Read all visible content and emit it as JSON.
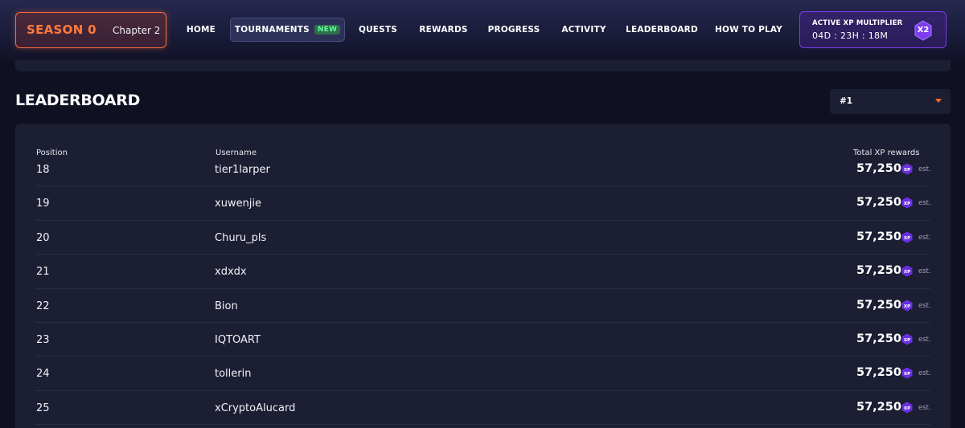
{
  "season": {
    "title": "SEASON 0",
    "chapter": "Chapter 2"
  },
  "nav": {
    "home": "HOME",
    "tournaments": "TOURNAMENTS",
    "tournaments_badge": "NEW",
    "quests": "QUESTS",
    "rewards": "REWARDS",
    "progress": "PROGRESS",
    "activity": "ACTIVITY",
    "leaderboard": "LEADERBOARD",
    "how_to_play": "HOW TO PLAY"
  },
  "multiplier": {
    "title": "ACTIVE XP MULTIPLIER",
    "timer": "04D : 23H : 18M",
    "badge": "X2"
  },
  "page": {
    "title": "LEADERBOARD",
    "rank_select": "#1"
  },
  "table": {
    "headers": {
      "position": "Position",
      "username": "Username",
      "xp": "Total XP rewards"
    },
    "xp_icon_label": "XP",
    "est_label": "est.",
    "rows": [
      {
        "position": "18",
        "username": "tier1larper",
        "xp": "57,250"
      },
      {
        "position": "19",
        "username": "xuwenjie",
        "xp": "57,250"
      },
      {
        "position": "20",
        "username": "Churu_pls",
        "xp": "57,250"
      },
      {
        "position": "21",
        "username": "xdxdx",
        "xp": "57,250"
      },
      {
        "position": "22",
        "username": "Bion",
        "xp": "57,250"
      },
      {
        "position": "23",
        "username": "IQTOART",
        "xp": "57,250"
      },
      {
        "position": "24",
        "username": "tollerin",
        "xp": "57,250"
      },
      {
        "position": "25",
        "username": "xCryptoAlucard",
        "xp": "57,250"
      }
    ]
  },
  "colors": {
    "accent_orange": "#ff6a3d",
    "accent_purple": "#7d3cf0",
    "badge_green": "#5dff9a"
  }
}
